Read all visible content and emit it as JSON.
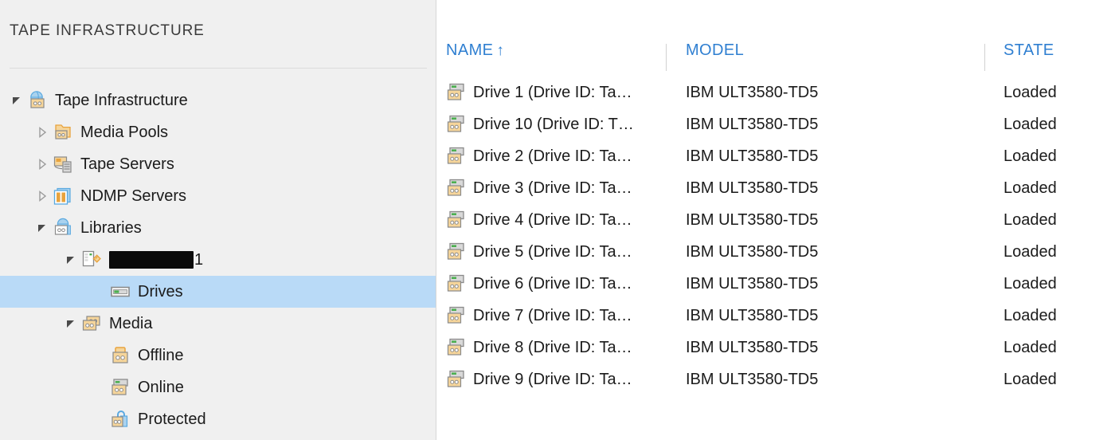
{
  "sidebar": {
    "header": "TAPE INFRASTRUCTURE",
    "selection_color": "#b9daf7",
    "background_color": "#f0f0f0",
    "items": [
      {
        "label": "Tape Infrastructure",
        "icon": "tape-globe-icon",
        "depth": 0,
        "twisty": "expanded",
        "selected": false
      },
      {
        "label": "Media Pools",
        "icon": "media-pool-folder-icon",
        "depth": 1,
        "twisty": "collapsed",
        "selected": false
      },
      {
        "label": "Tape Servers",
        "icon": "tape-server-icon",
        "depth": 1,
        "twisty": "collapsed",
        "selected": false
      },
      {
        "label": "NDMP Servers",
        "icon": "ndmp-server-icon",
        "depth": 1,
        "twisty": "collapsed",
        "selected": false
      },
      {
        "label": "Libraries",
        "icon": "libraries-icon",
        "depth": 1,
        "twisty": "expanded",
        "selected": false
      },
      {
        "label": "1",
        "icon": "library-device-icon",
        "depth": 2,
        "twisty": "expanded",
        "selected": false,
        "redacted": true
      },
      {
        "label": "Drives",
        "icon": "drive-icon",
        "depth": 3,
        "twisty": "none",
        "selected": true
      },
      {
        "label": "Media",
        "icon": "media-icon",
        "depth": 2,
        "twisty": "expanded",
        "selected": false
      },
      {
        "label": "Offline",
        "icon": "media-offline-icon",
        "depth": 3,
        "twisty": "none",
        "selected": false
      },
      {
        "label": "Online",
        "icon": "media-online-icon",
        "depth": 3,
        "twisty": "none",
        "selected": false
      },
      {
        "label": "Protected",
        "icon": "media-protected-icon",
        "depth": 3,
        "twisty": "none",
        "selected": false
      }
    ]
  },
  "grid": {
    "sort_column": "NAME",
    "sort_direction": "ascending",
    "sort_arrow_glyph": "↑",
    "header_color": "#2f7fd1",
    "columns": [
      {
        "key": "name",
        "label": "NAME"
      },
      {
        "key": "model",
        "label": "MODEL"
      },
      {
        "key": "state",
        "label": "STATE"
      }
    ],
    "rows": [
      {
        "name": "Drive 1 (Drive ID: Ta…",
        "model": "IBM ULT3580-TD5",
        "state": "Loaded",
        "icon": "tape-drive-icon"
      },
      {
        "name": "Drive 10 (Drive ID: T…",
        "model": "IBM ULT3580-TD5",
        "state": "Loaded",
        "icon": "tape-drive-icon"
      },
      {
        "name": "Drive 2 (Drive ID: Ta…",
        "model": "IBM ULT3580-TD5",
        "state": "Loaded",
        "icon": "tape-drive-icon"
      },
      {
        "name": "Drive 3 (Drive ID: Ta…",
        "model": "IBM ULT3580-TD5",
        "state": "Loaded",
        "icon": "tape-drive-icon"
      },
      {
        "name": "Drive 4 (Drive ID: Ta…",
        "model": "IBM ULT3580-TD5",
        "state": "Loaded",
        "icon": "tape-drive-icon"
      },
      {
        "name": "Drive 5 (Drive ID: Ta…",
        "model": "IBM ULT3580-TD5",
        "state": "Loaded",
        "icon": "tape-drive-icon"
      },
      {
        "name": "Drive 6 (Drive ID: Ta…",
        "model": "IBM ULT3580-TD5",
        "state": "Loaded",
        "icon": "tape-drive-icon"
      },
      {
        "name": "Drive 7 (Drive ID: Ta…",
        "model": "IBM ULT3580-TD5",
        "state": "Loaded",
        "icon": "tape-drive-icon"
      },
      {
        "name": "Drive 8 (Drive ID: Ta…",
        "model": "IBM ULT3580-TD5",
        "state": "Loaded",
        "icon": "tape-drive-icon"
      },
      {
        "name": "Drive 9 (Drive ID: Ta…",
        "model": "IBM ULT3580-TD5",
        "state": "Loaded",
        "icon": "tape-drive-icon"
      }
    ]
  }
}
